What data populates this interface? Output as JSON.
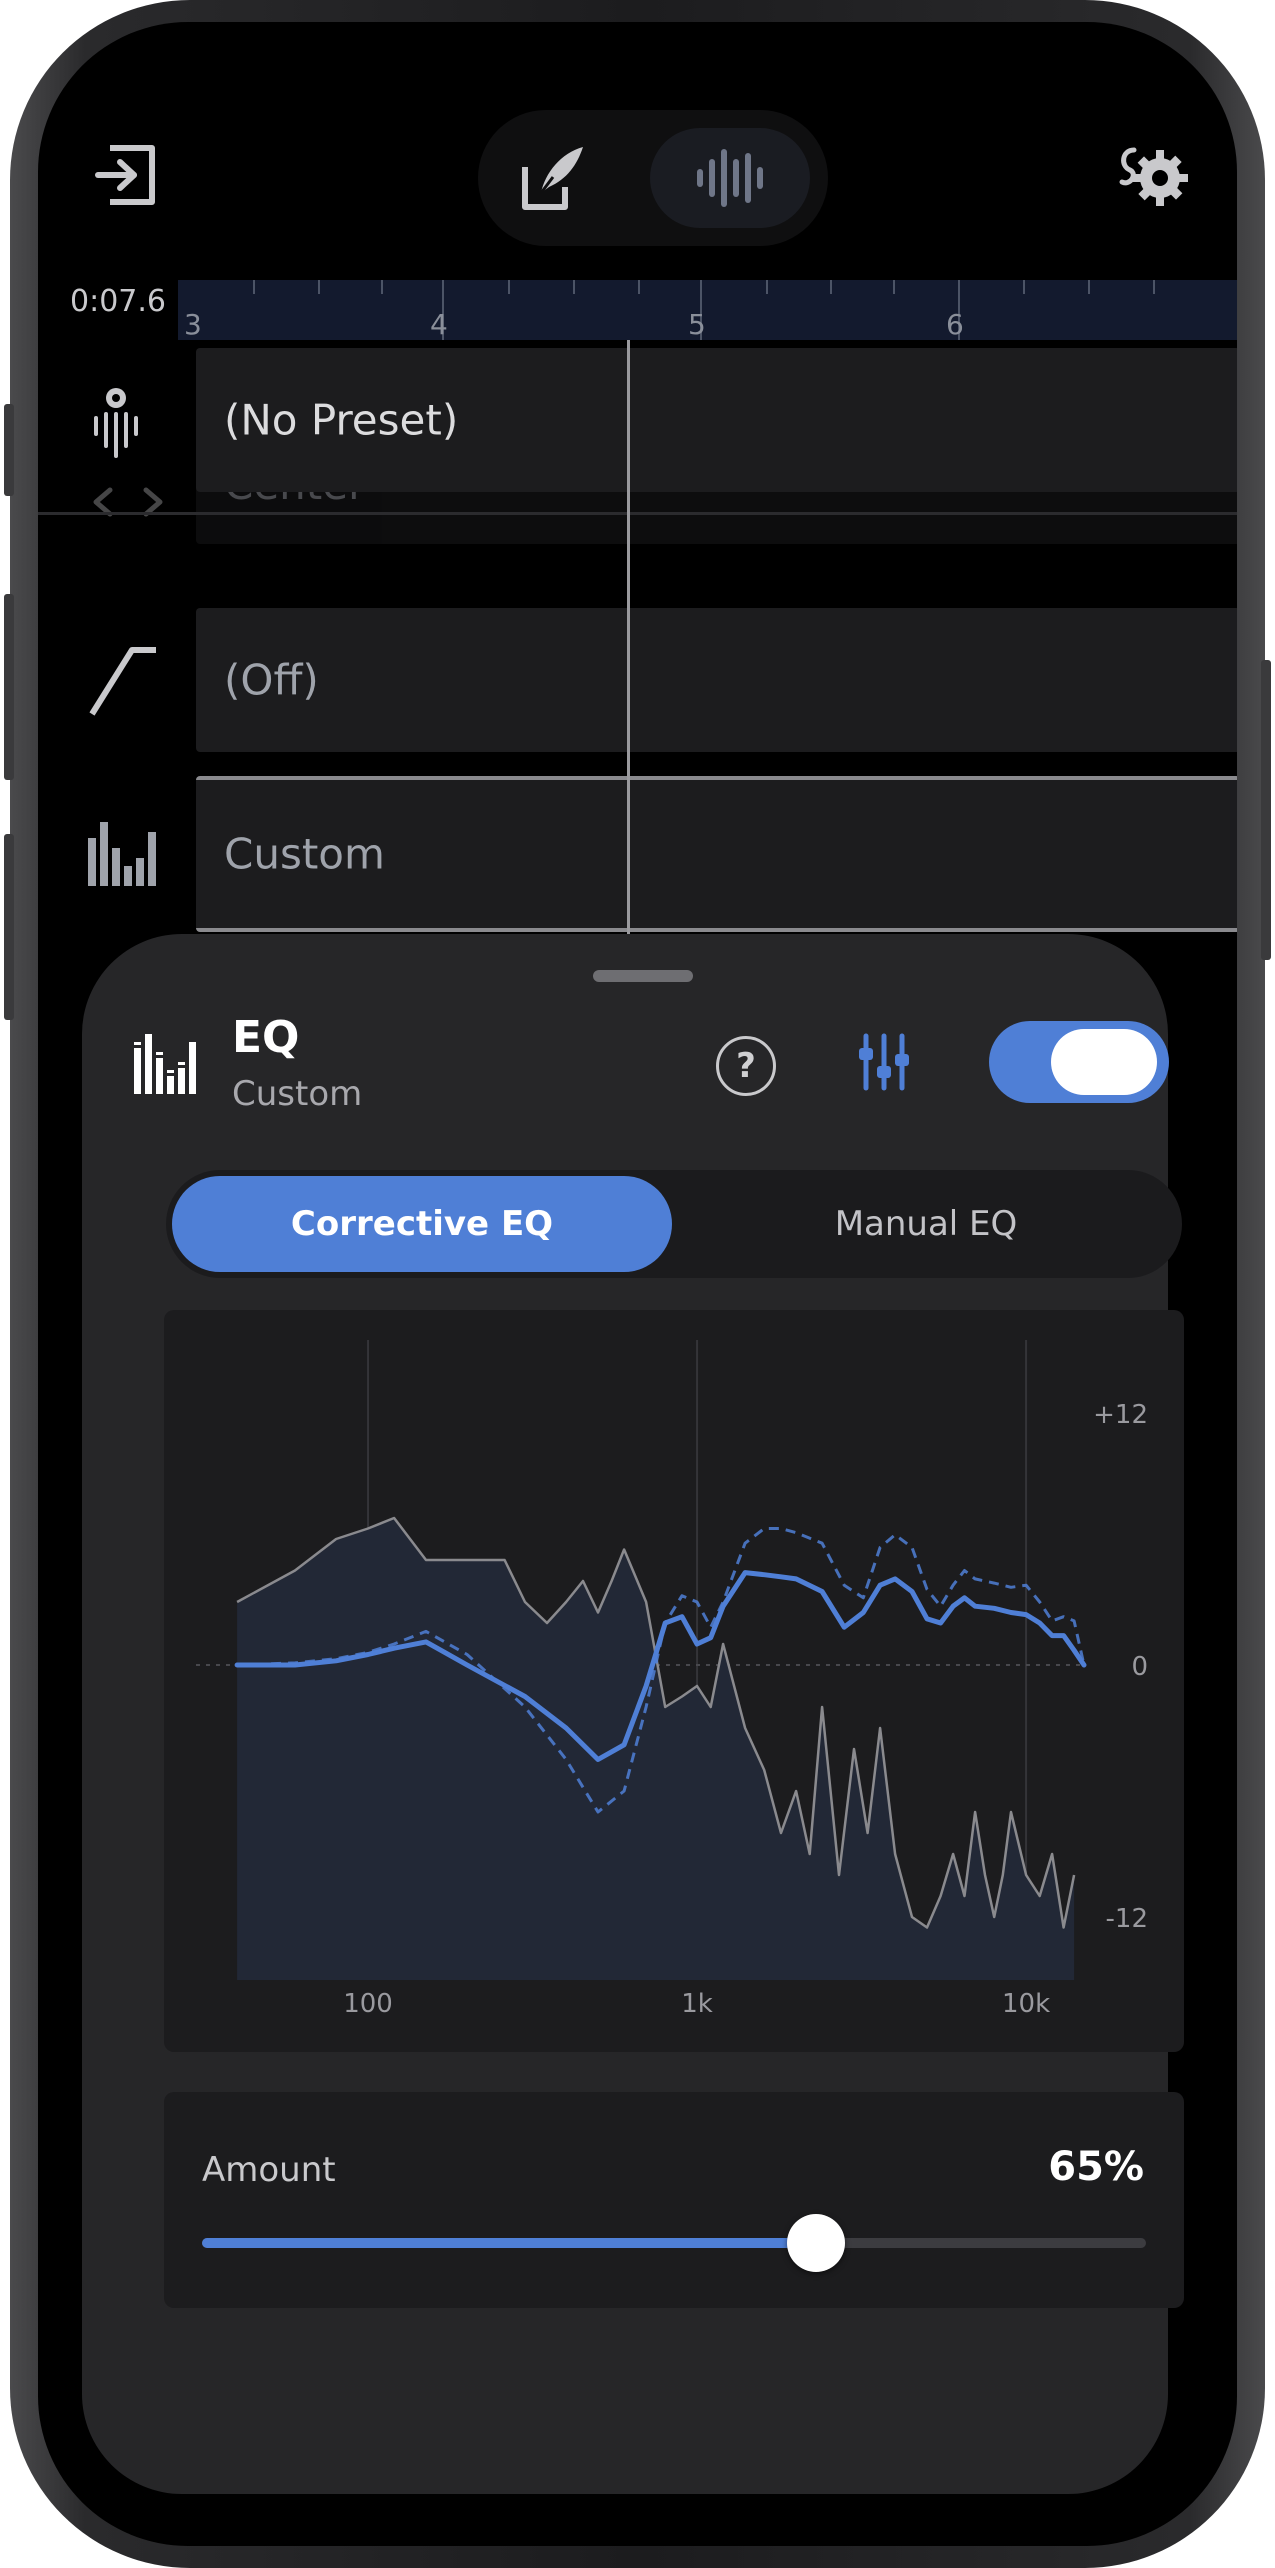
{
  "topbar": {
    "exit_icon": "exit-icon",
    "edit_icon": "quill-edit-icon",
    "audio_icon": "waveform-icon",
    "settings_icon": "music-settings-icon"
  },
  "timeline": {
    "time_readout": "0:07.6",
    "ruler_labels": [
      "3",
      "4",
      "5",
      "6"
    ]
  },
  "tracks": {
    "preset": "(No Preset)",
    "center": "Center",
    "fade": "(Off)",
    "eq": "Custom"
  },
  "sheet": {
    "title": "EQ",
    "subtitle": "Custom",
    "help_label": "?",
    "enabled": true,
    "tabs": {
      "corrective": "Corrective EQ",
      "manual": "Manual EQ",
      "active": "corrective"
    },
    "amount": {
      "label": "Amount",
      "value_text": "65%",
      "value": 0.65
    }
  },
  "chart_data": {
    "type": "line",
    "x_scale": "log",
    "xlim": [
      30,
      15000
    ],
    "ylim": [
      -15,
      15
    ],
    "x_ticks": [
      {
        "value": 100,
        "label": "100"
      },
      {
        "value": 1000,
        "label": "1k"
      },
      {
        "value": 10000,
        "label": "10k"
      }
    ],
    "y_ticks": [
      {
        "value": 12,
        "label": "+12"
      },
      {
        "value": 0,
        "label": "0"
      },
      {
        "value": -12,
        "label": "-12"
      }
    ],
    "series": [
      {
        "style": "spectrum-fill",
        "color": "#8a8a8e",
        "x": [
          40,
          60,
          80,
          100,
          120,
          150,
          200,
          260,
          300,
          350,
          400,
          450,
          500,
          550,
          600,
          700,
          800,
          900,
          1000,
          1100,
          1200,
          1400,
          1600,
          1800,
          2000,
          2200,
          2400,
          2700,
          3000,
          3300,
          3600,
          4000,
          4500,
          5000,
          5500,
          6000,
          6500,
          7000,
          7500,
          8000,
          8500,
          9000,
          10000,
          11000,
          12000,
          13000,
          14000
        ],
        "y": [
          3,
          4.5,
          6,
          6.5,
          7,
          5,
          5,
          5,
          3,
          2,
          3,
          4,
          2.5,
          4,
          5.5,
          3,
          -2,
          -1.5,
          -1,
          -2,
          1,
          -3,
          -5,
          -8,
          -6,
          -9,
          -2,
          -10,
          -4,
          -8,
          -3,
          -9,
          -12,
          -12.5,
          -11,
          -9,
          -11,
          -7,
          -10,
          -12,
          -10,
          -7,
          -10,
          -11,
          -9,
          -12.5,
          -10
        ]
      },
      {
        "style": "dashed",
        "color": "#4f7fd6",
        "x": [
          40,
          60,
          80,
          100,
          120,
          150,
          200,
          300,
          400,
          500,
          600,
          700,
          800,
          900,
          1000,
          1100,
          1200,
          1400,
          1600,
          1800,
          2000,
          2400,
          2800,
          3200,
          3600,
          4000,
          4500,
          5000,
          5500,
          6000,
          6500,
          7000,
          8000,
          9000,
          10000,
          11000,
          12000,
          13000,
          14000,
          15000
        ],
        "y": [
          0,
          0.1,
          0.3,
          0.6,
          1,
          1.6,
          0.5,
          -2,
          -4.5,
          -7,
          -6,
          -2,
          2,
          3.3,
          3,
          1.8,
          3,
          5.8,
          6.5,
          6.5,
          6.3,
          5.8,
          3.8,
          3.2,
          5.6,
          6.2,
          5.6,
          3.6,
          2.8,
          3.8,
          4.5,
          4.1,
          3.9,
          3.7,
          3.8,
          3,
          2.1,
          2.3,
          2.1,
          0
        ]
      },
      {
        "style": "solid",
        "color": "#4f7fd6",
        "x": [
          40,
          60,
          80,
          100,
          120,
          150,
          200,
          300,
          400,
          500,
          600,
          700,
          800,
          900,
          1000,
          1100,
          1200,
          1400,
          1600,
          1800,
          2000,
          2400,
          2800,
          3200,
          3600,
          4000,
          4500,
          5000,
          5500,
          6000,
          6500,
          7000,
          8000,
          9000,
          10000,
          11000,
          12000,
          13000,
          14000,
          15000
        ],
        "y": [
          0,
          0,
          0.2,
          0.5,
          0.8,
          1.1,
          0,
          -1.5,
          -3,
          -4.5,
          -3.8,
          -1,
          2,
          2.3,
          1,
          1.3,
          2.8,
          4.4,
          4.3,
          4.2,
          4.1,
          3.5,
          1.8,
          2.5,
          3.8,
          4.1,
          3.5,
          2.2,
          2,
          2.8,
          3.2,
          2.8,
          2.7,
          2.5,
          2.4,
          2,
          1.4,
          1.4,
          0.7,
          0
        ]
      }
    ]
  }
}
